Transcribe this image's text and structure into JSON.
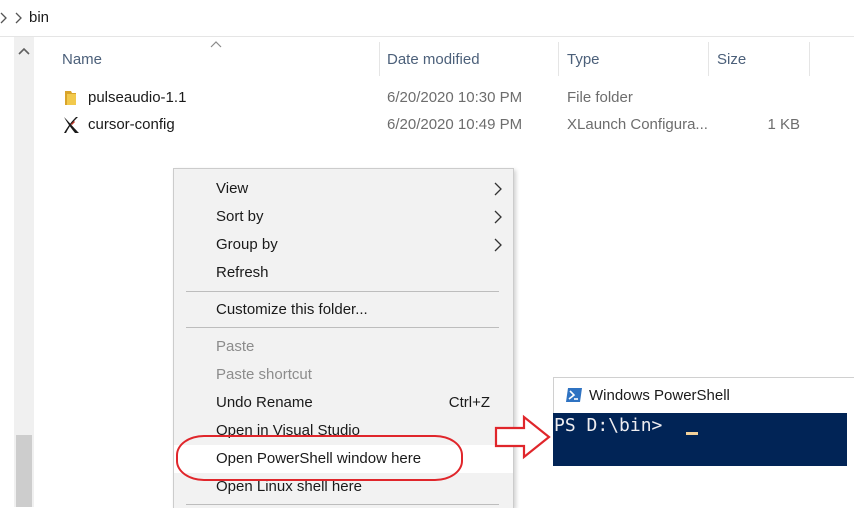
{
  "breadcrumb": {
    "current": "bin"
  },
  "columns": {
    "name": "Name",
    "date": "Date modified",
    "type": "Type",
    "size": "Size"
  },
  "files": [
    {
      "name": "pulseaudio-1.1",
      "date": "6/20/2020 10:30 PM",
      "type": "File folder",
      "size": "",
      "icon": "folder-icon"
    },
    {
      "name": "cursor-config",
      "date": "6/20/2020 10:49 PM",
      "type": "XLaunch Configura...",
      "size": "1 KB",
      "icon": "xlaunch-icon"
    }
  ],
  "context_menu": {
    "view": "View",
    "sort_by": "Sort by",
    "group_by": "Group by",
    "refresh": "Refresh",
    "customize": "Customize this folder...",
    "paste": "Paste",
    "paste_shortcut": "Paste shortcut",
    "undo_rename": "Undo Rename",
    "undo_shortcut": "Ctrl+Z",
    "open_vs": "Open in Visual Studio",
    "open_powershell": "Open PowerShell window here",
    "open_linux": "Open Linux shell here"
  },
  "powershell": {
    "title": "Windows PowerShell",
    "prompt": "PS D:\\bin> "
  },
  "colors": {
    "annotation": "#e0262b",
    "console_bg": "#012456",
    "folder": "#e8b73f"
  }
}
